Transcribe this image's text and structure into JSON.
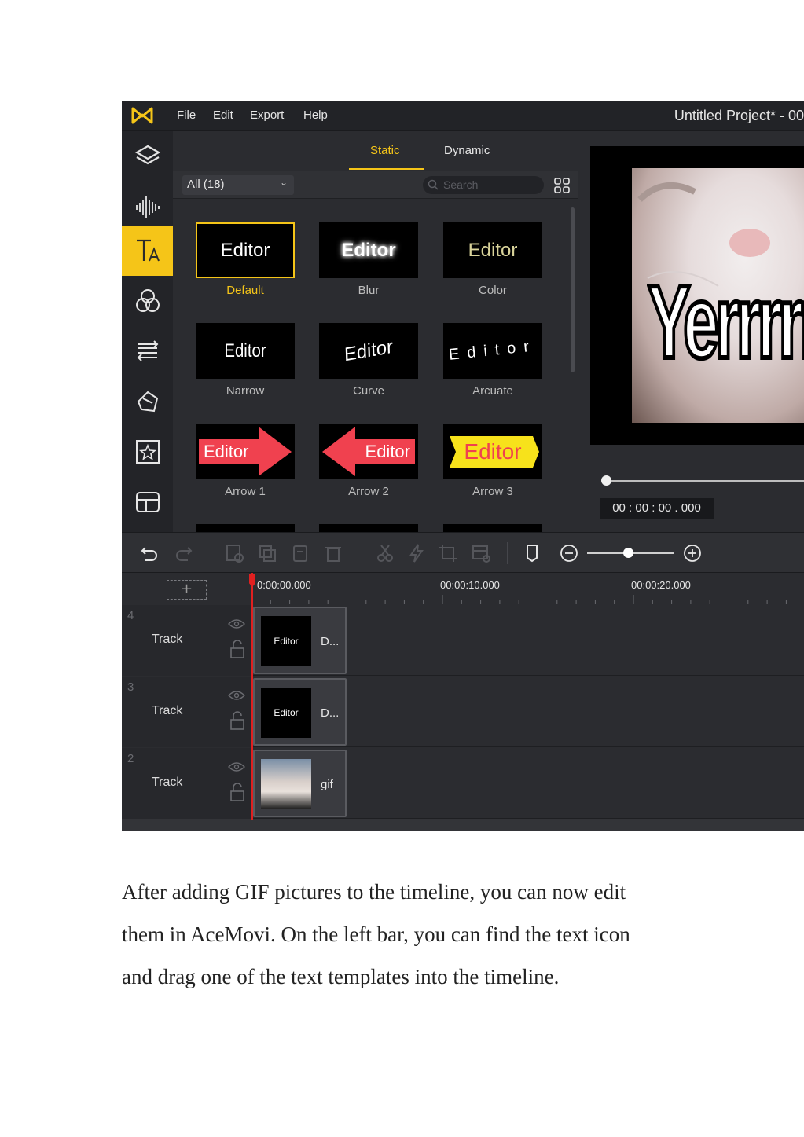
{
  "menubar": {
    "items": [
      "File",
      "Edit",
      "Export",
      "Help"
    ],
    "title": "Untitled Project* - 00"
  },
  "panel": {
    "tabs": [
      "Static",
      "Dynamic"
    ],
    "filter_value": "All (18)",
    "search_placeholder": "Search"
  },
  "templates": [
    {
      "text": "Editor",
      "label": "Default"
    },
    {
      "text": "Editor",
      "label": "Blur"
    },
    {
      "text": "Editor",
      "label": "Color"
    },
    {
      "text": "Editor",
      "label": "Narrow"
    },
    {
      "text": "Editor",
      "label": "Curve"
    },
    {
      "text": "Editor",
      "label": "Arcuate"
    },
    {
      "text": "Editor",
      "label": "Arrow 1"
    },
    {
      "text": "Editor",
      "label": "Arrow 2"
    },
    {
      "text": "Editor",
      "label": "Arrow 3"
    }
  ],
  "preview": {
    "caption": "Yerrrrr",
    "timecode": "00 : 00 : 00 . 000"
  },
  "timeline": {
    "ticks": [
      "0:00:00.000",
      "00:00:10.000",
      "00:00:20.000"
    ],
    "tracks": [
      {
        "number": "4",
        "name": "Track",
        "clip_thumb": "Editor",
        "clip_label": "D..."
      },
      {
        "number": "3",
        "name": "Track",
        "clip_thumb": "Editor",
        "clip_label": "D..."
      },
      {
        "number": "2",
        "name": "Track",
        "clip_thumb": "",
        "clip_label": "gif"
      }
    ]
  },
  "colors": {
    "accent": "#f5c518",
    "playhead": "#e02020",
    "arrow_red": "#f0414f",
    "arrow_yellow": "#f7e21b"
  },
  "paragraph": {
    "lines": [
      "After adding GIF pictures to the timeline, you can now edit",
      "them in AceMovi. On the left bar, you can find the text icon",
      "and drag one of the text templates into the timeline."
    ]
  }
}
